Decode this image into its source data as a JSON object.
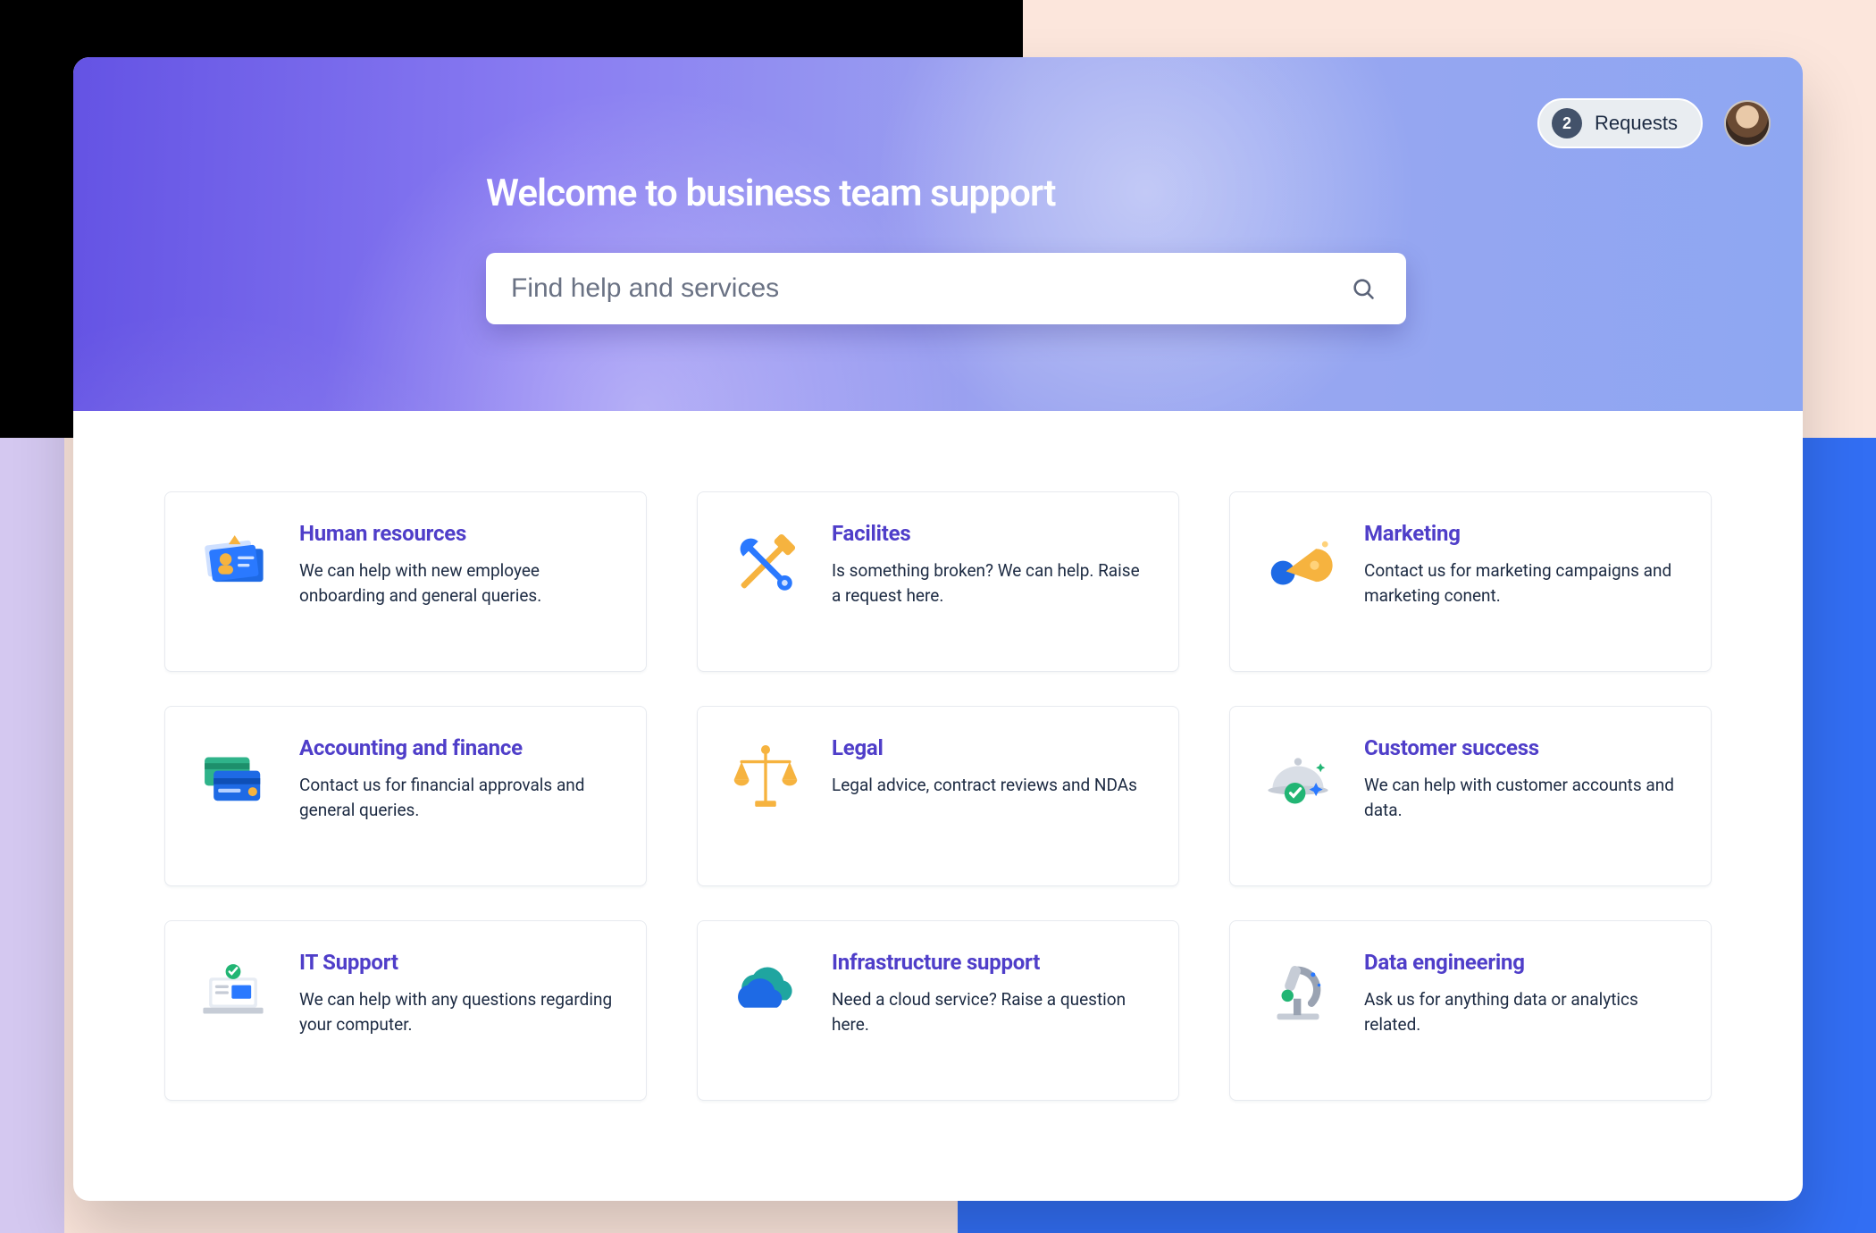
{
  "hero": {
    "title": "Welcome to business team support",
    "search_placeholder": "Find help and services"
  },
  "topbar": {
    "requests_count": "2",
    "requests_label": "Requests"
  },
  "cards": [
    {
      "icon": "hr",
      "title": "Human resources",
      "desc": "We can help with new employee onboarding and general queries."
    },
    {
      "icon": "facilities",
      "title": "Facilites",
      "desc": "Is something broken? We can help. Raise a request here."
    },
    {
      "icon": "marketing",
      "title": "Marketing",
      "desc": "Contact us for marketing campaigns and marketing conent."
    },
    {
      "icon": "accounting",
      "title": "Accounting and finance",
      "desc": "Contact us for financial approvals and general queries."
    },
    {
      "icon": "legal",
      "title": "Legal",
      "desc": "Legal advice, contract reviews and NDAs"
    },
    {
      "icon": "customer",
      "title": "Customer success",
      "desc": "We can help with customer accounts and data."
    },
    {
      "icon": "it",
      "title": "IT Support",
      "desc": "We can help with any questions regarding your computer."
    },
    {
      "icon": "infra",
      "title": "Infrastructure support",
      "desc": "Need a cloud service? Raise a question here."
    },
    {
      "icon": "data",
      "title": "Data engineering",
      "desc": "Ask us for anything data or analytics related."
    }
  ]
}
